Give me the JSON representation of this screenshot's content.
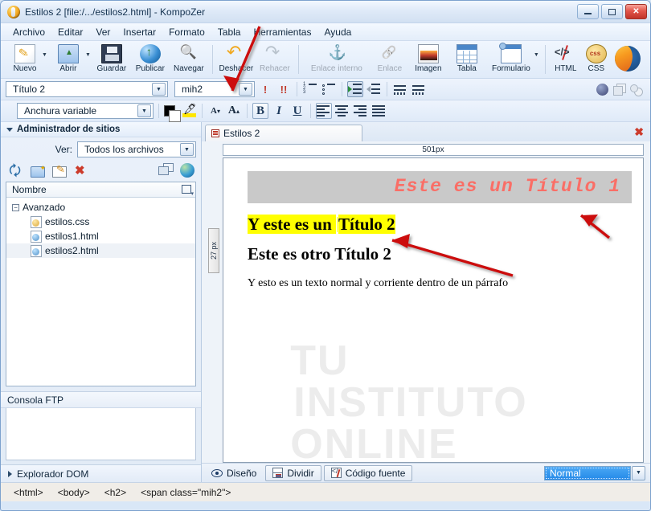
{
  "window": {
    "title": "Estilos 2 [file:/.../estilos2.html] - KompoZer",
    "logo_icon": "kompozer-logo-icon",
    "minimize_label": "−",
    "maximize_label": "□",
    "close_label": "✕"
  },
  "menubar": [
    {
      "label": "Archivo",
      "accel": "A"
    },
    {
      "label": "Editar",
      "accel": "E"
    },
    {
      "label": "Ver",
      "accel": "V"
    },
    {
      "label": "Insertar",
      "accel": "I"
    },
    {
      "label": "Formato",
      "accel": "o"
    },
    {
      "label": "Tabla",
      "accel": "b"
    },
    {
      "label": "Herramientas",
      "accel": "H"
    },
    {
      "label": "Ayuda",
      "accel": "y"
    }
  ],
  "toolbar": {
    "buttons": [
      {
        "label": "Nuevo",
        "icon": "new-document-icon",
        "has_dropdown": true,
        "disabled": false
      },
      {
        "label": "Abrir",
        "icon": "open-folder-icon",
        "has_dropdown": true,
        "disabled": false
      },
      {
        "label": "Guardar",
        "icon": "save-disk-icon",
        "has_dropdown": false,
        "disabled": false
      },
      {
        "label": "Publicar",
        "icon": "publish-globe-icon",
        "has_dropdown": false,
        "disabled": false
      },
      {
        "label": "Navegar",
        "icon": "browse-magnifier-icon",
        "has_dropdown": false,
        "disabled": false
      },
      {
        "label": "Deshacer",
        "icon": "undo-arrow-icon",
        "has_dropdown": false,
        "disabled": false
      },
      {
        "label": "Rehacer",
        "icon": "redo-arrow-icon",
        "has_dropdown": false,
        "disabled": true
      },
      {
        "label": "Enlace interno",
        "icon": "anchor-icon",
        "has_dropdown": false,
        "disabled": true
      },
      {
        "label": "Enlace",
        "icon": "link-chain-icon",
        "has_dropdown": false,
        "disabled": true
      },
      {
        "label": "Imagen",
        "icon": "image-picture-icon",
        "has_dropdown": false,
        "disabled": false
      },
      {
        "label": "Tabla",
        "icon": "table-grid-icon",
        "has_dropdown": false,
        "disabled": false
      },
      {
        "label": "Formulario",
        "icon": "form-window-icon",
        "has_dropdown": true,
        "disabled": false
      },
      {
        "label": "HTML",
        "icon": "html-tag-icon",
        "has_dropdown": false,
        "disabled": false
      },
      {
        "label": "CSS",
        "icon": "css-palette-icon",
        "has_dropdown": false,
        "disabled": false
      }
    ],
    "browser_icon": "firefox-globe-icon"
  },
  "format_bar": {
    "paragraph_format": "Título 2",
    "class_name": "mih2",
    "font_width": "Anchura variable",
    "decrease_indent_label": "!",
    "increase_indent_label": "!!",
    "icons": [
      "numbered-list-icon",
      "bulleted-list-icon",
      "indent-more-icon",
      "indent-less-icon",
      "spellcheck-icon",
      "spellcheck-all-icon",
      "color-swatch-icon",
      "highlighter-icon",
      "decrease-font-icon",
      "increase-font-icon",
      "bold-icon",
      "italic-icon",
      "underline-icon",
      "align-left-icon",
      "align-center-icon",
      "align-right-icon",
      "align-justify-icon",
      "css-editor-icon",
      "layer-icon",
      "absolute-position-icon"
    ],
    "bold_label": "B",
    "italic_label": "I",
    "underline_label": "U",
    "decrease_font_label": "A",
    "increase_font_label": "A"
  },
  "sidebar": {
    "panel_title": "Administrador de sitios",
    "panel_collapse_icon": "chevron-down-icon",
    "view_label": "Ver:",
    "view_value": "Todos los archivos",
    "tools": [
      {
        "name": "refresh-icon"
      },
      {
        "name": "new-folder-icon"
      },
      {
        "name": "edit-site-icon"
      },
      {
        "name": "delete-icon"
      },
      {
        "name": "manage-sites-icon"
      },
      {
        "name": "site-globe-icon"
      }
    ],
    "file_column_header": "Nombre",
    "column_chooser_icon": "column-chooser-icon",
    "tree": [
      {
        "label": "Avanzado",
        "type": "folder",
        "expanded": true,
        "selected": false
      },
      {
        "label": "estilos.css",
        "type": "css",
        "selected": false
      },
      {
        "label": "estilos1.html",
        "type": "html",
        "selected": false
      },
      {
        "label": "estilos2.html",
        "type": "html",
        "selected": true
      }
    ],
    "ftp_console_title": "Consola FTP",
    "dom_explorer_title": "Explorador DOM",
    "dom_expand_icon": "chevron-right-icon"
  },
  "editor": {
    "tab_label": "Estilos 2",
    "tab_icon": "document-icon",
    "close_all_icon": "close-tab-icon",
    "horizontal_ruler_label": "501px",
    "vertical_ruler_label": "27 px",
    "watermark_line1": "TU",
    "watermark_line2": "INSTITUTO",
    "watermark_line3": "ONLINE",
    "content": {
      "heading1": "Este es un Título 1",
      "heading2_highlight_part1": "Y este es un ",
      "heading2_highlight_part2": "Título 2",
      "heading2_plain": "Este es otro Título 2",
      "paragraph": "Y esto es un texto normal y corriente dentro de un párrafo"
    },
    "colors": {
      "heading1_color": "#fa6e66",
      "heading1_background": "#c9c9c9",
      "heading2_highlight": "#ffff00",
      "accent_blue": "#2489e8",
      "annotation_red": "#cc1111"
    },
    "mode_tabs": [
      {
        "label": "Diseño",
        "icon": "eye-icon",
        "active": true
      },
      {
        "label": "Dividir",
        "icon": "split-view-icon",
        "active": false
      },
      {
        "label": "Código fuente",
        "icon": "source-code-icon",
        "active": false
      }
    ],
    "view_mode": "Normal",
    "view_mode_arrow_icon": "chevron-down-icon"
  },
  "statusbar": {
    "breadcrumb": [
      "<html>",
      "<body>",
      "<h2>",
      "<span class=\"mih2\">"
    ]
  }
}
